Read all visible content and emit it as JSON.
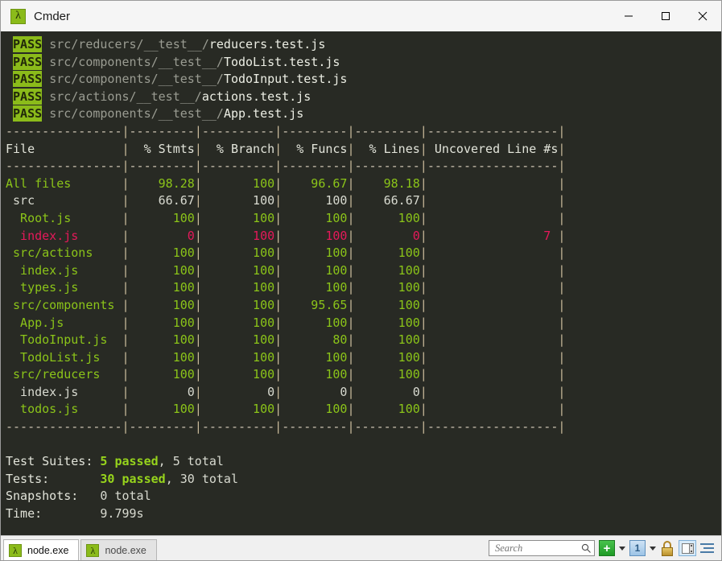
{
  "window": {
    "title": "Cmder",
    "icon": "lambda-icon",
    "controls": {
      "minimize": "—",
      "maximize": "□",
      "close": "✕"
    }
  },
  "terminal": {
    "test_results": [
      {
        "status": "PASS",
        "dir": "src/reducers/__test__/",
        "file": "reducers.test.js"
      },
      {
        "status": "PASS",
        "dir": "src/components/__test__/",
        "file": "TodoList.test.js"
      },
      {
        "status": "PASS",
        "dir": "src/components/__test__/",
        "file": "TodoInput.test.js"
      },
      {
        "status": "PASS",
        "dir": "src/actions/__test__/",
        "file": "actions.test.js"
      },
      {
        "status": "PASS",
        "dir": "src/components/__test__/",
        "file": "App.test.js"
      }
    ],
    "coverage_table": {
      "separator_segments": [
        "----------------",
        "---------",
        "----------",
        "---------",
        "---------",
        "------------------"
      ],
      "headers": [
        "File",
        "% Stmts",
        "% Branch",
        "% Funcs",
        "% Lines",
        "Uncovered Line #s"
      ],
      "rows": [
        {
          "indent": 0,
          "name": "All files",
          "stmts": "98.28",
          "branch": "100",
          "funcs": "96.67",
          "lines": "98.18",
          "uncovered": "",
          "color": "green"
        },
        {
          "indent": 1,
          "name": "src",
          "stmts": "66.67",
          "branch": "100",
          "funcs": "100",
          "lines": "66.67",
          "uncovered": "",
          "color": "white"
        },
        {
          "indent": 2,
          "name": "Root.js",
          "stmts": "100",
          "branch": "100",
          "funcs": "100",
          "lines": "100",
          "uncovered": "",
          "color": "green"
        },
        {
          "indent": 2,
          "name": "index.js",
          "stmts": "0",
          "branch": "100",
          "funcs": "100",
          "lines": "0",
          "uncovered": "7",
          "color": "red"
        },
        {
          "indent": 1,
          "name": "src/actions",
          "stmts": "100",
          "branch": "100",
          "funcs": "100",
          "lines": "100",
          "uncovered": "",
          "color": "green"
        },
        {
          "indent": 2,
          "name": "index.js",
          "stmts": "100",
          "branch": "100",
          "funcs": "100",
          "lines": "100",
          "uncovered": "",
          "color": "green"
        },
        {
          "indent": 2,
          "name": "types.js",
          "stmts": "100",
          "branch": "100",
          "funcs": "100",
          "lines": "100",
          "uncovered": "",
          "color": "green"
        },
        {
          "indent": 1,
          "name": "src/components",
          "stmts": "100",
          "branch": "100",
          "funcs": "95.65",
          "lines": "100",
          "uncovered": "",
          "color": "green"
        },
        {
          "indent": 2,
          "name": "App.js",
          "stmts": "100",
          "branch": "100",
          "funcs": "100",
          "lines": "100",
          "uncovered": "",
          "color": "green"
        },
        {
          "indent": 2,
          "name": "TodoInput.js",
          "stmts": "100",
          "branch": "100",
          "funcs": "80",
          "lines": "100",
          "uncovered": "",
          "color": "green"
        },
        {
          "indent": 2,
          "name": "TodoList.js",
          "stmts": "100",
          "branch": "100",
          "funcs": "100",
          "lines": "100",
          "uncovered": "",
          "color": "green"
        },
        {
          "indent": 1,
          "name": "src/reducers",
          "stmts": "100",
          "branch": "100",
          "funcs": "100",
          "lines": "100",
          "uncovered": "",
          "color": "green"
        },
        {
          "indent": 2,
          "name": "index.js",
          "stmts": "0",
          "branch": "0",
          "funcs": "0",
          "lines": "0",
          "uncovered": "",
          "color": "white"
        },
        {
          "indent": 2,
          "name": "todos.js",
          "stmts": "100",
          "branch": "100",
          "funcs": "100",
          "lines": "100",
          "uncovered": "",
          "color": "green"
        }
      ]
    },
    "summary": [
      {
        "label": "Test Suites:",
        "passed": "5 passed",
        "rest": ", 5 total"
      },
      {
        "label": "Tests:",
        "passed": "30 passed",
        "rest": ", 30 total"
      },
      {
        "label": "Snapshots:",
        "passed": "",
        "rest": "0 total"
      },
      {
        "label": "Time:",
        "passed": "",
        "rest": "9.799s"
      }
    ]
  },
  "statusbar": {
    "tabs": [
      {
        "label": "node.exe",
        "icon": "lambda-icon",
        "active": true
      },
      {
        "label": "node.exe",
        "icon": "lambda-icon",
        "active": false
      }
    ],
    "search": {
      "placeholder": "Search",
      "value": "",
      "icon": "search-icon"
    },
    "buttons": {
      "new_console": "+",
      "new_console_dropdown": "chevron-down-icon",
      "active_console": "1",
      "console_dropdown": "chevron-down-icon",
      "lock": "lock-icon",
      "split_pane": "split-pane-icon",
      "menu": "hamburger-menu-icon"
    }
  },
  "colors": {
    "terminal_bg": "#282a24",
    "pass_badge": "#8bbb1a",
    "green": "#8bc419",
    "red": "#e5195a",
    "white": "#d8dad0",
    "dim": "#9a9c92",
    "separator": "#c8b99a"
  }
}
